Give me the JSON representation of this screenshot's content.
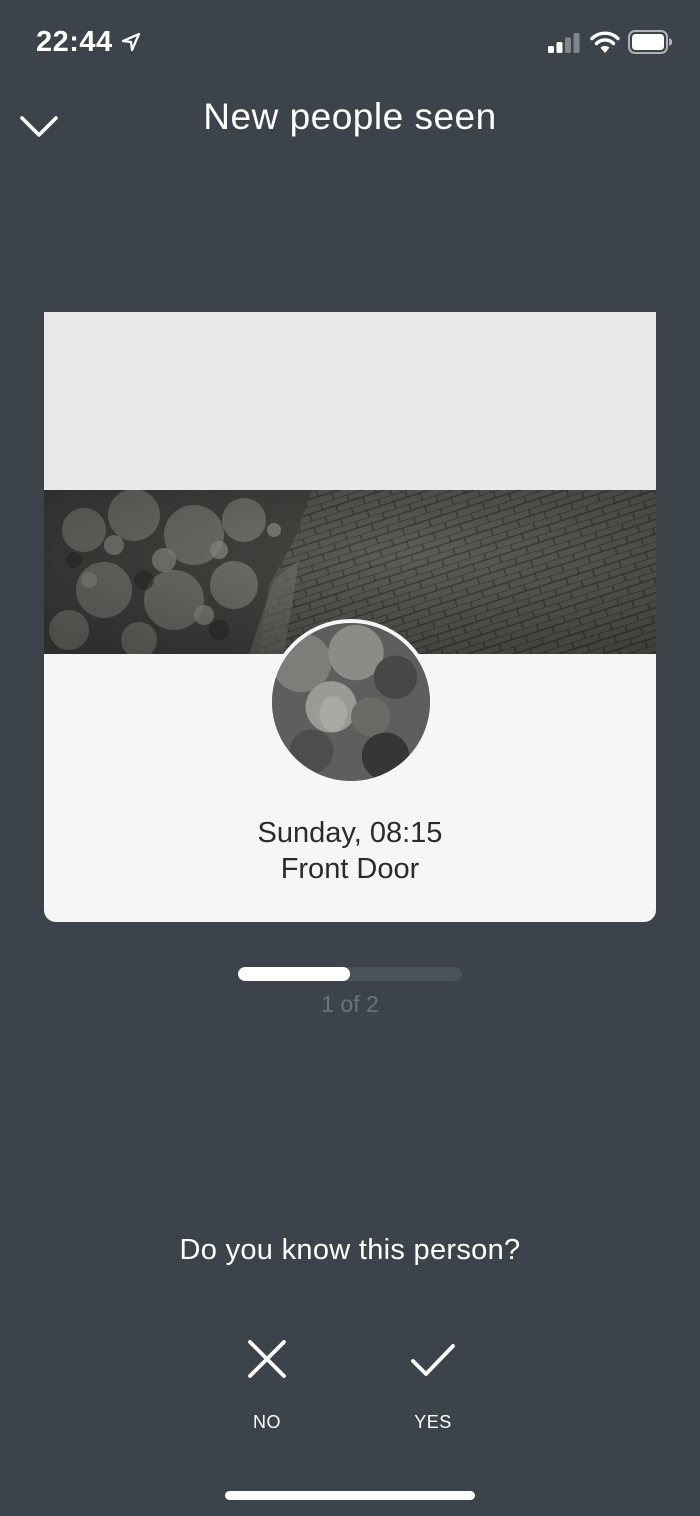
{
  "status_bar": {
    "time": "22:44",
    "icons": [
      "location-arrow-icon",
      "cellular-signal-icon",
      "wifi-icon",
      "battery-icon"
    ]
  },
  "header": {
    "title": "New people seen",
    "back_icon": "chevron-down-icon"
  },
  "card": {
    "event_time": "Sunday, 08:15",
    "event_location": "Front Door"
  },
  "pager": {
    "label": "1 of 2",
    "progress_fraction": 0.5
  },
  "prompt": {
    "question": "Do you know this person?",
    "no_label": "NO",
    "yes_label": "YES",
    "no_icon": "close-icon",
    "yes_icon": "checkmark-icon"
  },
  "colors": {
    "background": "#3c434a",
    "card": "#f6f6f6",
    "accent": "#ffffff"
  }
}
